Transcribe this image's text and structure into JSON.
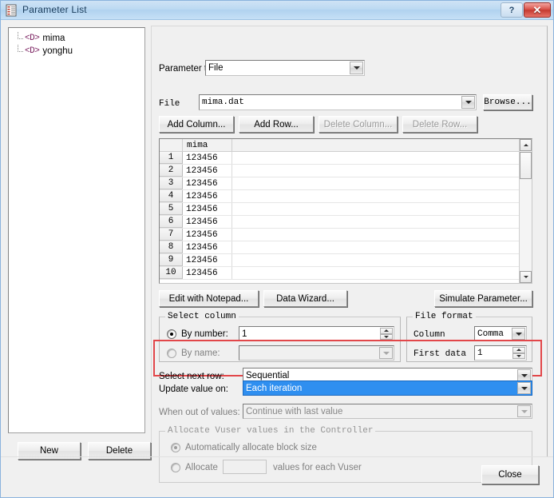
{
  "window": {
    "title": "Parameter List",
    "icon": "parameter-list-icon",
    "help_label": "?",
    "close_label": "✕"
  },
  "tree": {
    "items": [
      {
        "icon": "<D>",
        "label": "mima"
      },
      {
        "icon": "<D>",
        "label": "yonghu"
      }
    ]
  },
  "parameter_type": {
    "label": "Parameter type:",
    "value": "File"
  },
  "file": {
    "label": "File",
    "value": "mima.dat",
    "browse_label": "Browse..."
  },
  "grid_buttons": {
    "add_column": "Add Column...",
    "add_row": "Add Row...",
    "delete_column": "Delete Column...",
    "delete_row": "Delete Row..."
  },
  "grid": {
    "column_header": "mima",
    "rows": [
      {
        "num": "1",
        "value": "123456"
      },
      {
        "num": "2",
        "value": "123456"
      },
      {
        "num": "3",
        "value": "123456"
      },
      {
        "num": "4",
        "value": "123456"
      },
      {
        "num": "5",
        "value": "123456"
      },
      {
        "num": "6",
        "value": "123456"
      },
      {
        "num": "7",
        "value": "123456"
      },
      {
        "num": "8",
        "value": "123456"
      },
      {
        "num": "9",
        "value": "123456"
      },
      {
        "num": "10",
        "value": "123456"
      }
    ]
  },
  "tool_buttons": {
    "edit_notepad": "Edit with Notepad...",
    "data_wizard": "Data Wizard...",
    "simulate_parameter": "Simulate Parameter..."
  },
  "select_column": {
    "title": "Select column",
    "by_number_label": "By number:",
    "by_number_value": "1",
    "by_name_label": "By name:",
    "by_name_value": ""
  },
  "file_format": {
    "title": "File format",
    "column_label": "Column",
    "column_value": "Comma",
    "first_data_label": "First data",
    "first_data_value": "1"
  },
  "row_options": {
    "select_next_row_label": "Select next row:",
    "select_next_row_value": "Sequential",
    "update_value_on_label": "Update value on:",
    "update_value_on_value": "Each iteration",
    "highlight_color": "#e2474a",
    "selection_color": "#2f8ff0"
  },
  "out_of_values": {
    "label": "When out of values:",
    "value": "Continue with last value"
  },
  "allocate": {
    "title": "Allocate Vuser values in the Controller",
    "auto_label": "Automatically allocate block size",
    "allocate_label": "Allocate",
    "allocate_value": "",
    "allocate_suffix": "values for each Vuser"
  },
  "footer": {
    "new_label": "New",
    "delete_label": "Delete",
    "close_label": "Close"
  }
}
